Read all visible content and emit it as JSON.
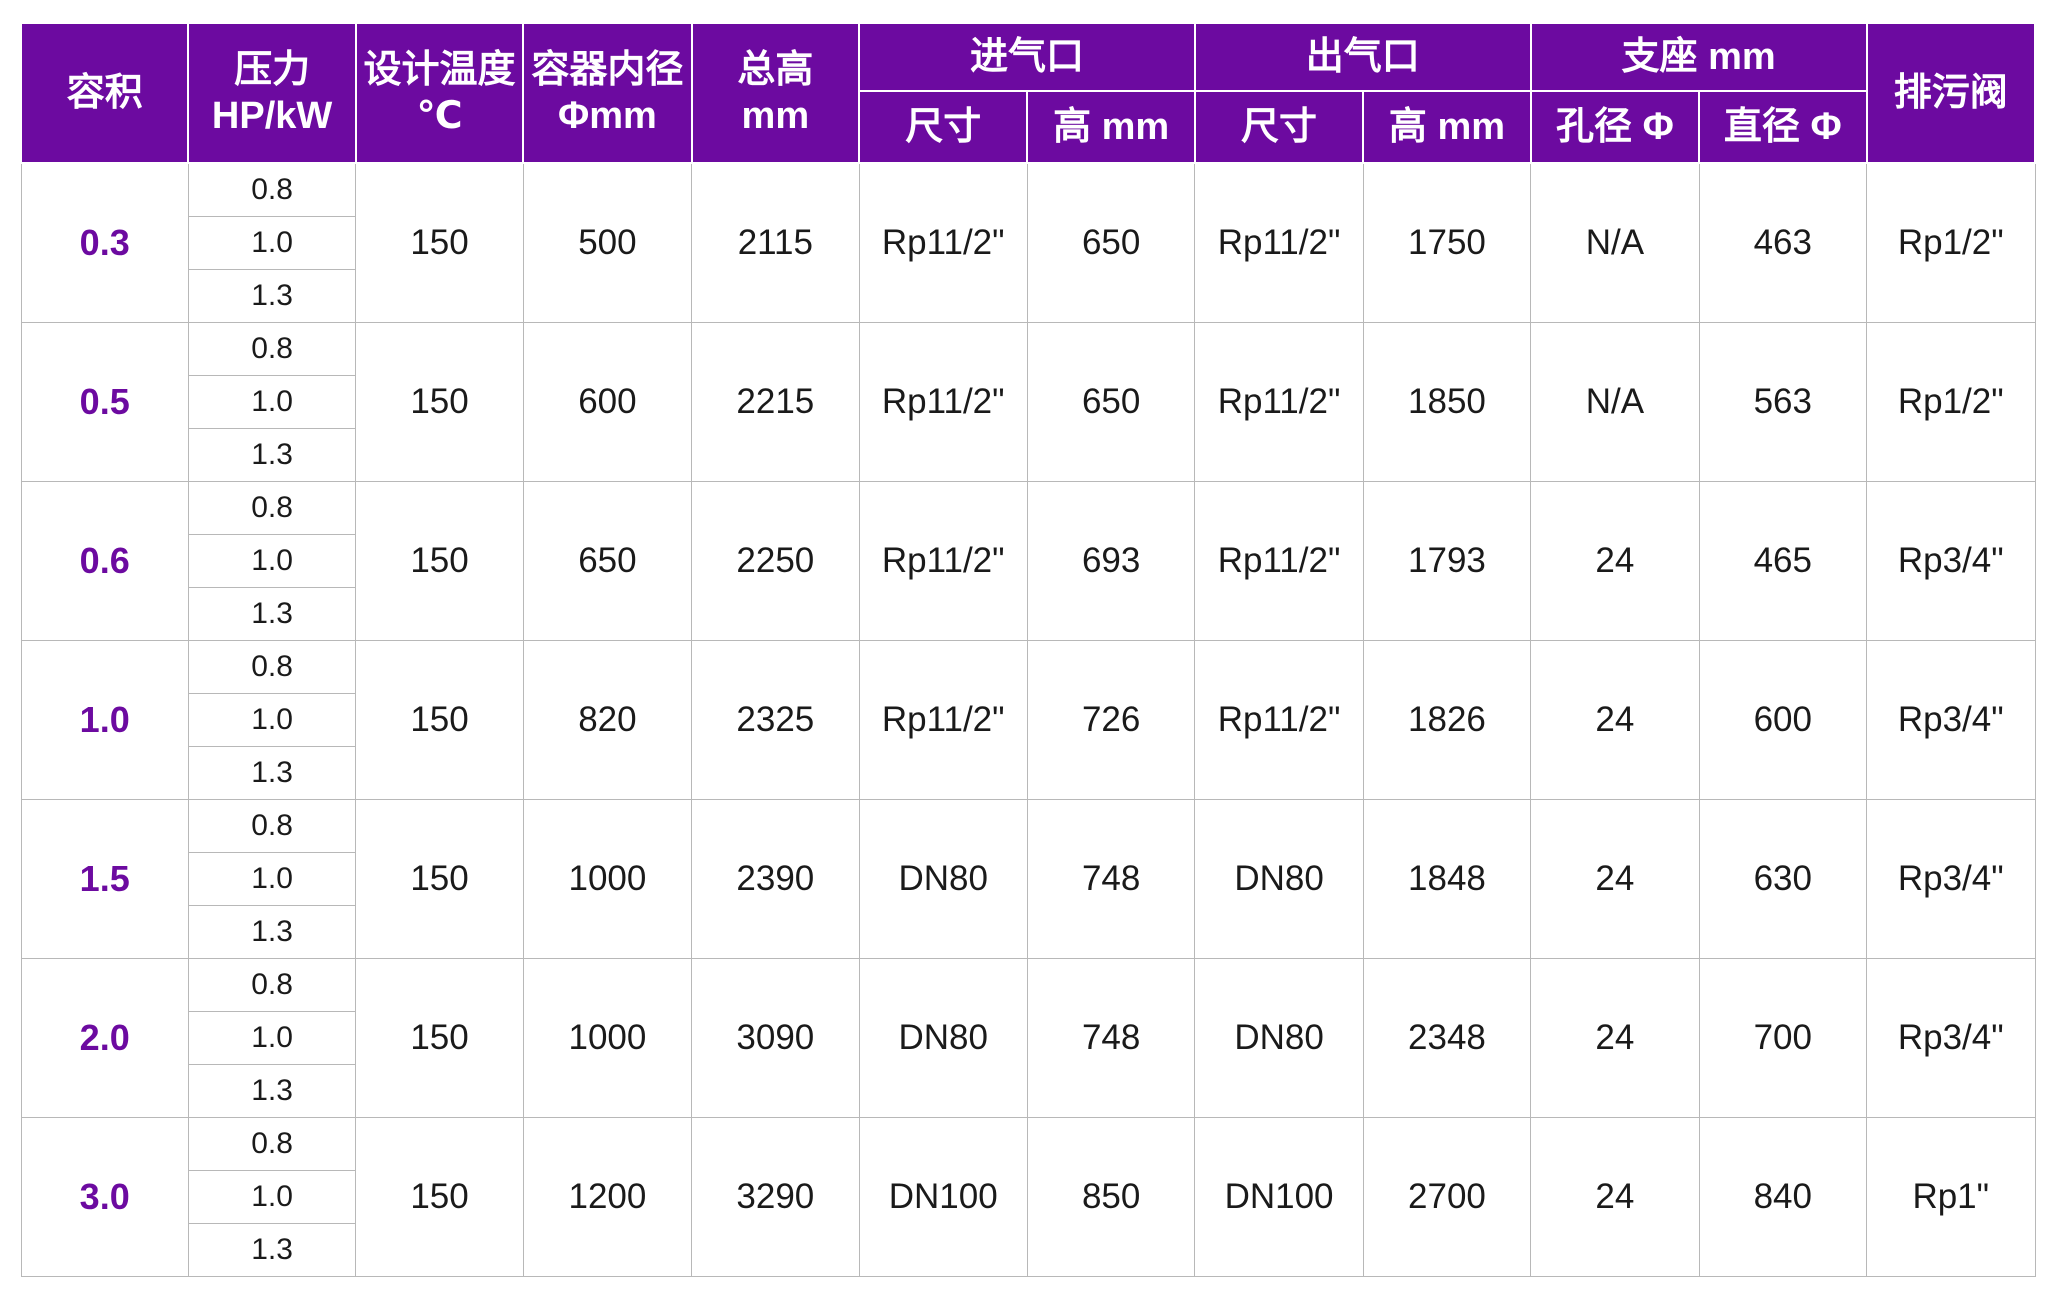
{
  "headers": {
    "volume": "容积",
    "pressure_line1": "压力",
    "pressure_line2": "HP/kW",
    "design_temp_line1": "设计温度",
    "design_temp_line2": "℃",
    "inner_diameter_line1": "容器内径",
    "inner_diameter_line2": "Φmm",
    "total_height_line1": "总高",
    "total_height_line2": "mm",
    "inlet": "进气口",
    "outlet": "出气口",
    "support": "支座 mm",
    "drain_valve": "排污阀",
    "inlet_size": "尺寸",
    "inlet_height": "高 mm",
    "outlet_size": "尺寸",
    "outlet_height": "高 mm",
    "support_hole": "孔径 Φ",
    "support_diameter": "直径 Φ"
  },
  "rows": [
    {
      "volume": "0.3",
      "pressures": [
        "0.8",
        "1.0",
        "1.3"
      ],
      "design_temp": "150",
      "inner_diameter": "500",
      "total_height": "2115",
      "inlet_size": "Rp11/2\"",
      "inlet_height": "650",
      "outlet_size": "Rp11/2\"",
      "outlet_height": "1750",
      "support_hole": "N/A",
      "support_diameter": "463",
      "drain_valve": "Rp1/2\""
    },
    {
      "volume": "0.5",
      "pressures": [
        "0.8",
        "1.0",
        "1.3"
      ],
      "design_temp": "150",
      "inner_diameter": "600",
      "total_height": "2215",
      "inlet_size": "Rp11/2\"",
      "inlet_height": "650",
      "outlet_size": "Rp11/2\"",
      "outlet_height": "1850",
      "support_hole": "N/A",
      "support_diameter": "563",
      "drain_valve": "Rp1/2\""
    },
    {
      "volume": "0.6",
      "pressures": [
        "0.8",
        "1.0",
        "1.3"
      ],
      "design_temp": "150",
      "inner_diameter": "650",
      "total_height": "2250",
      "inlet_size": "Rp11/2\"",
      "inlet_height": "693",
      "outlet_size": "Rp11/2\"",
      "outlet_height": "1793",
      "support_hole": "24",
      "support_diameter": "465",
      "drain_valve": "Rp3/4\""
    },
    {
      "volume": "1.0",
      "pressures": [
        "0.8",
        "1.0",
        "1.3"
      ],
      "design_temp": "150",
      "inner_diameter": "820",
      "total_height": "2325",
      "inlet_size": "Rp11/2\"",
      "inlet_height": "726",
      "outlet_size": "Rp11/2\"",
      "outlet_height": "1826",
      "support_hole": "24",
      "support_diameter": "600",
      "drain_valve": "Rp3/4\""
    },
    {
      "volume": "1.5",
      "pressures": [
        "0.8",
        "1.0",
        "1.3"
      ],
      "design_temp": "150",
      "inner_diameter": "1000",
      "total_height": "2390",
      "inlet_size": "DN80",
      "inlet_height": "748",
      "outlet_size": "DN80",
      "outlet_height": "1848",
      "support_hole": "24",
      "support_diameter": "630",
      "drain_valve": "Rp3/4\""
    },
    {
      "volume": "2.0",
      "pressures": [
        "0.8",
        "1.0",
        "1.3"
      ],
      "design_temp": "150",
      "inner_diameter": "1000",
      "total_height": "3090",
      "inlet_size": "DN80",
      "inlet_height": "748",
      "outlet_size": "DN80",
      "outlet_height": "2348",
      "support_hole": "24",
      "support_diameter": "700",
      "drain_valve": "Rp3/4\""
    },
    {
      "volume": "3.0",
      "pressures": [
        "0.8",
        "1.0",
        "1.3"
      ],
      "design_temp": "150",
      "inner_diameter": "1200",
      "total_height": "3290",
      "inlet_size": "DN100",
      "inlet_height": "850",
      "outlet_size": "DN100",
      "outlet_height": "2700",
      "support_hole": "24",
      "support_diameter": "840",
      "drain_valve": "Rp1\""
    }
  ],
  "colors": {
    "header_background": "#6c0aa0",
    "header_text": "#ffffff",
    "volume_text": "#6c0aa0",
    "body_text": "#1a1a1a",
    "grid_line": "#b8b8b8"
  }
}
